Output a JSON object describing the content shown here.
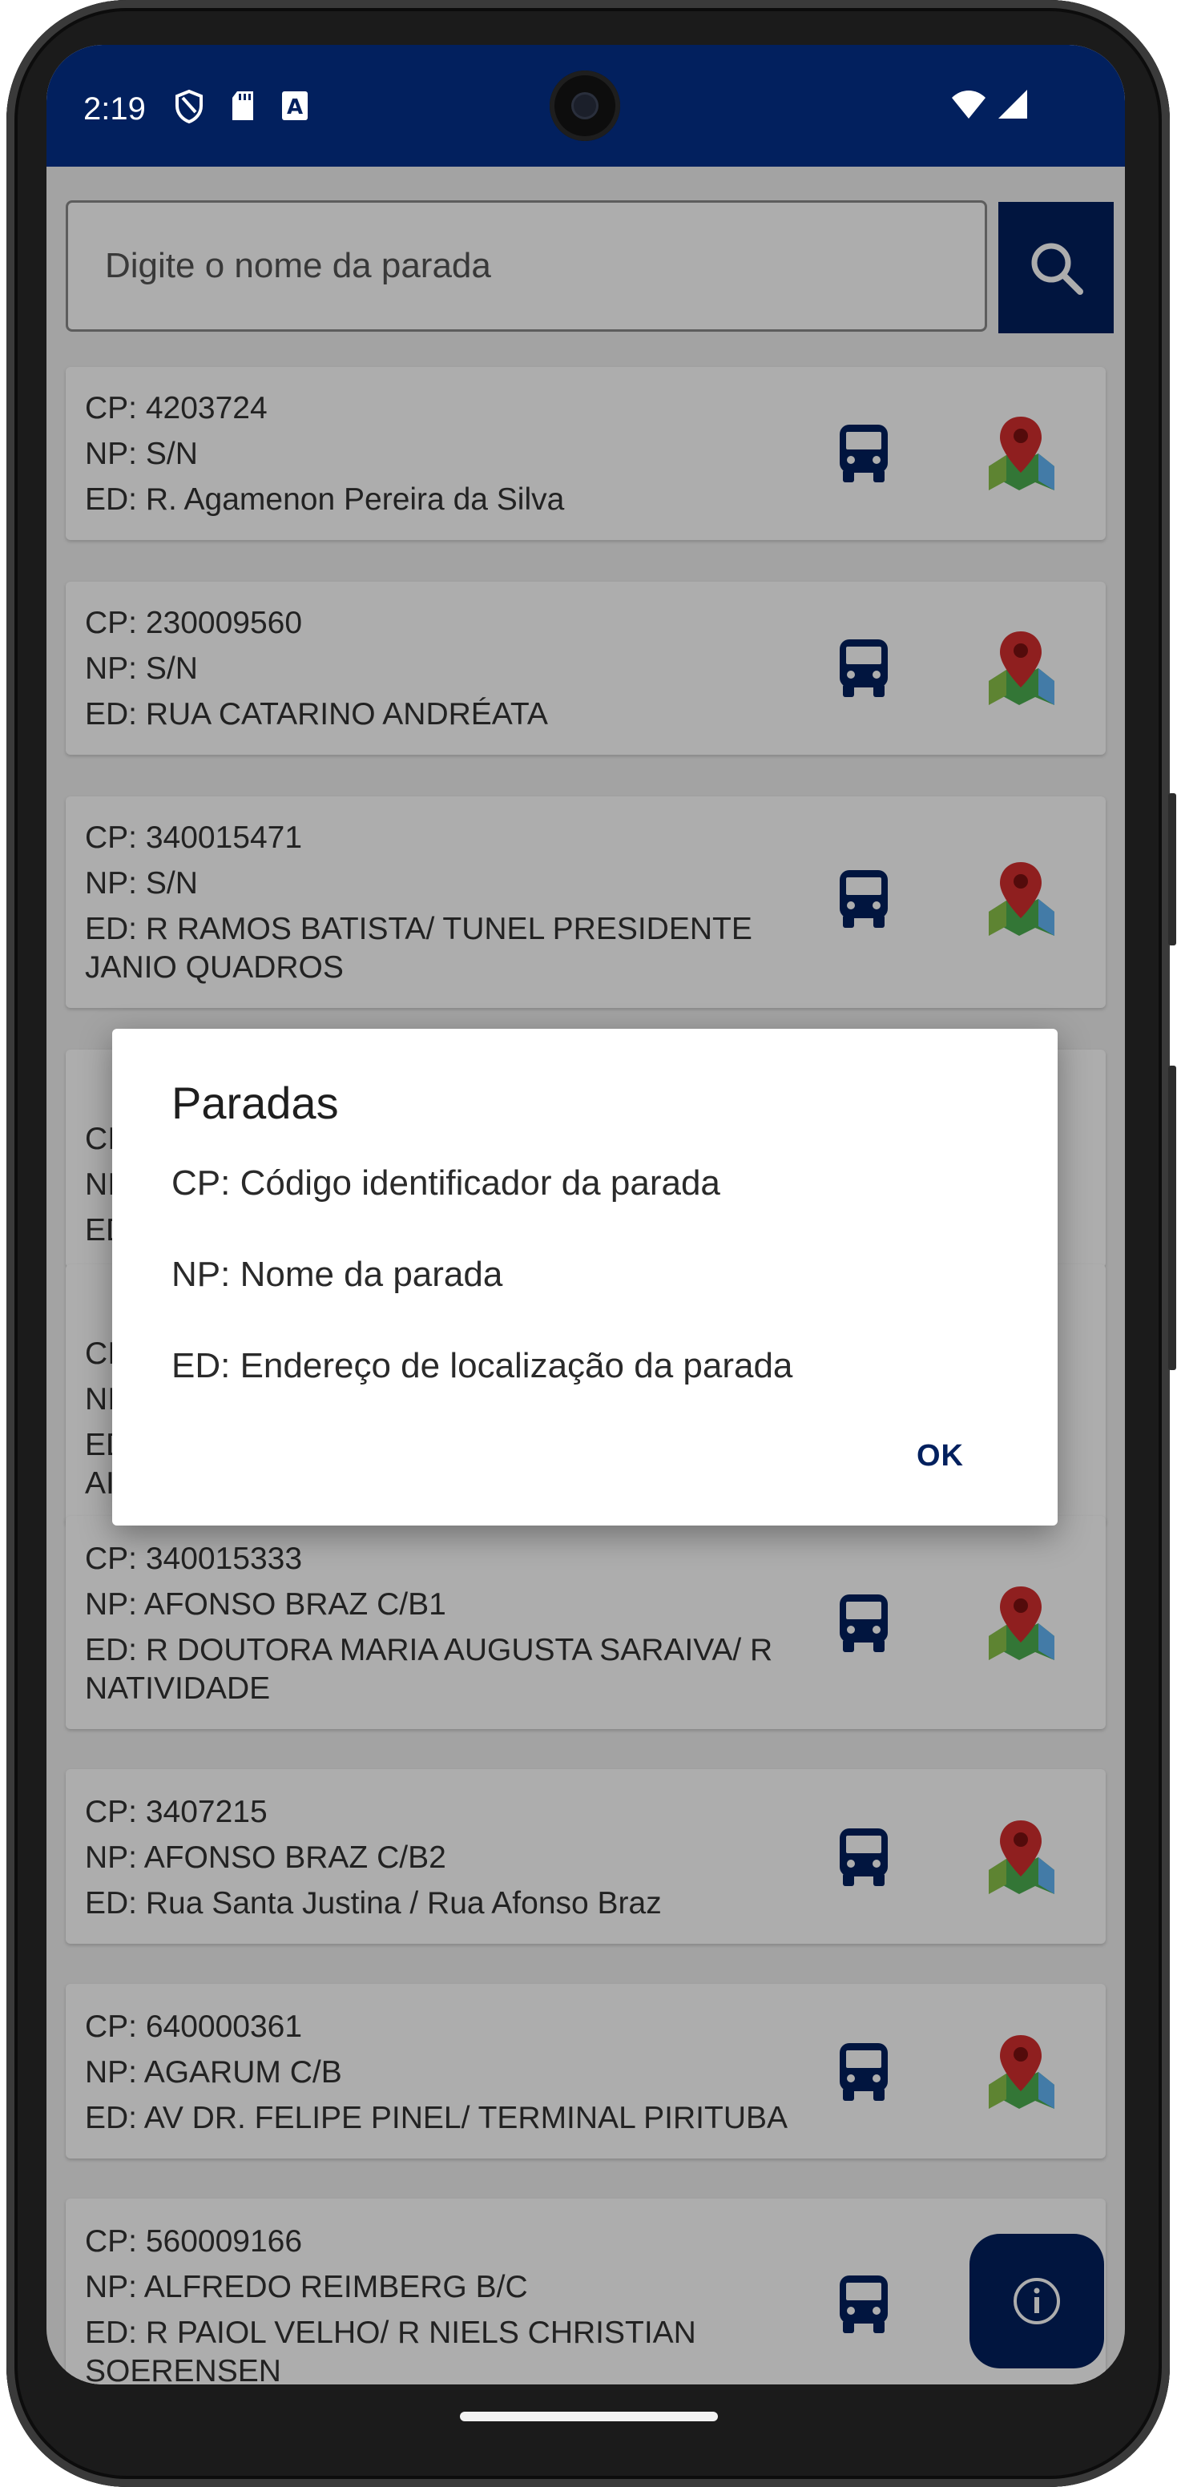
{
  "status_bar": {
    "time": "2:19",
    "icons": [
      "shield-icon",
      "sd-card-icon",
      "keyboard-a-icon",
      "wifi-icon",
      "signal-icon"
    ]
  },
  "search": {
    "placeholder": "Digite o nome da parada",
    "button_icon": "search-icon"
  },
  "stops": [
    {
      "cp": "CP: 4203724",
      "np": "NP: S/N",
      "ed": [
        "ED: R. Agamenon Pereira da Silva"
      ]
    },
    {
      "cp": "CP: 230009560",
      "np": "NP: S/N",
      "ed": [
        "ED: RUA CATARINO ANDRÉATA"
      ]
    },
    {
      "cp": "CP: 340015471",
      "np": "NP: S/N",
      "ed": [
        "ED: R RAMOS BATISTA/ TUNEL PRESIDENTE",
        "JANIO QUADROS"
      ]
    },
    {
      "cp": "CP: 340015333",
      "np": "NP: AFONSO BRAZ C/B1",
      "ed": [
        "ED: R DOUTORA MARIA AUGUSTA SARAIVA/ R",
        "NATIVIDADE"
      ]
    },
    {
      "cp": "CP: 3407215",
      "np": "NP: AFONSO BRAZ C/B2",
      "ed": [
        "ED: Rua Santa Justina / Rua Afonso Braz"
      ]
    },
    {
      "cp": "CP: 640000361",
      "np": "NP: AGARUM C/B",
      "ed": [
        "ED: AV DR. FELIPE PINEL/ TERMINAL PIRITUBA"
      ]
    },
    {
      "cp": "CP: 560009166",
      "np": "NP: ALFREDO REIMBERG B/C",
      "ed": [
        "ED: R PAIOL VELHO/ R NIELS CHRISTIAN",
        "SOERENSEN"
      ]
    }
  ],
  "hidden_card_prefixes": {
    "card4": [
      "CI",
      "NI",
      "ED"
    ],
    "card5": [
      "CI",
      "NI",
      "ED",
      "AI"
    ]
  },
  "fab_icon": "info-icon",
  "dialog": {
    "title": "Paradas",
    "lines": [
      "CP: Código identificador da parada",
      "NP: Nome da parada",
      "ED: Endereço de localização da parada"
    ],
    "ok_label": "OK"
  },
  "colors": {
    "primary": "#02205e",
    "pin_red": "#d32f2f",
    "background": "#f0f0f0"
  }
}
